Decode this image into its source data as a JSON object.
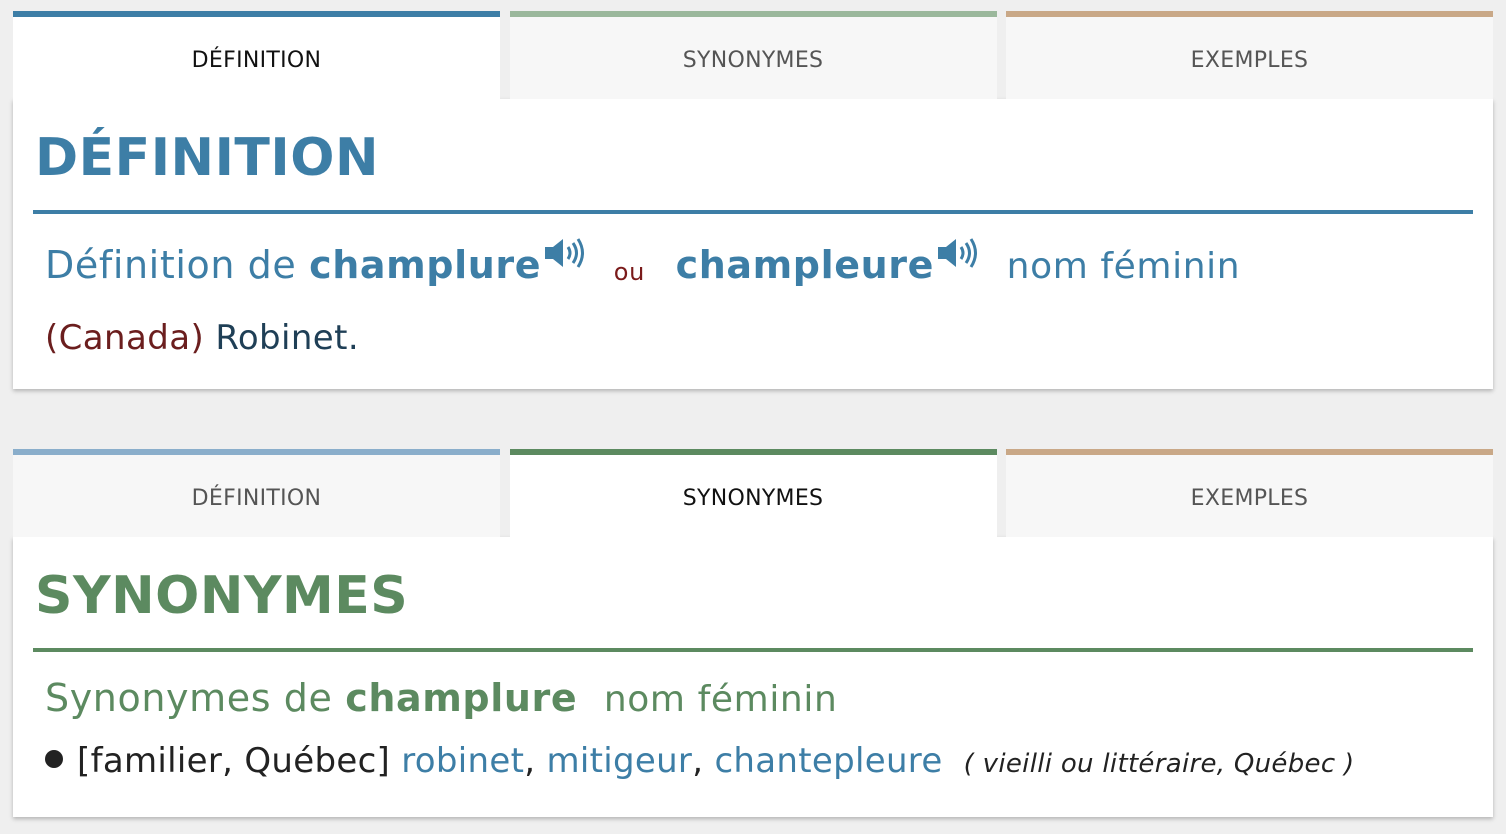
{
  "colors": {
    "definition_accent": "#3d7ea6",
    "definition_tab_faded": "#8aaecb",
    "synonyms_accent": "#5c8a60",
    "synonyms_tab_faded": "#9bb89c",
    "examples_tab": "#c9a887",
    "region_color": "#6b1e1e"
  },
  "tabs": {
    "definition": "DÉFINITION",
    "synonyms": "SYNONYMES",
    "examples": "EXEMPLES"
  },
  "definition_section": {
    "heading": "DÉFINITION",
    "prefix": "Définition de",
    "word1": "champlure",
    "or": "ou",
    "word2": "champleure",
    "pos": "nom féminin",
    "region": "(Canada)",
    "text": "Robinet.",
    "speaker_icon": "speaker-icon"
  },
  "synonyms_section": {
    "heading": "SYNONYMES",
    "prefix": "Synonymes de",
    "word": "champlure",
    "pos": "nom féminin",
    "register": "[familier, Québec]",
    "synonyms": [
      "robinet",
      "mitigeur",
      "chantepleure"
    ],
    "separator": ",",
    "note": "( vieilli ou littéraire, Québec )"
  }
}
